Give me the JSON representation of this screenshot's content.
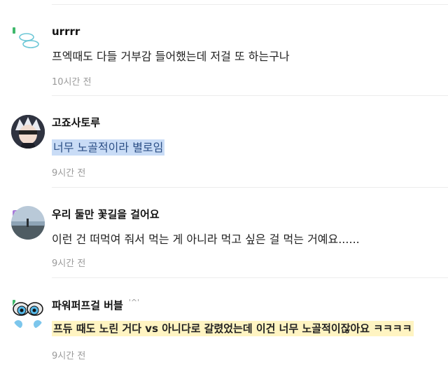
{
  "comments": [
    {
      "name": "urrrr",
      "name_extra": "",
      "text": "프엑때도 다들 거부감 들어했는데 저걸 또 하는구나",
      "time": "10시간 전"
    },
    {
      "name": "고죠사토루",
      "name_extra": "",
      "text": "너무 노골적이라 별로임",
      "time": "9시간 전"
    },
    {
      "name": "우리 둘만 꽃길을 걸어요",
      "name_extra": "",
      "text": "이런 건 떠먹여 줘서 먹는 게 아니라 먹고 싶은 걸 먹는 거예요......",
      "time": "9시간 전"
    },
    {
      "name": "파워퍼프걸 버블",
      "name_extra": "'^'",
      "text": "프듀 때도 노린 거다 vs 아니다로 갈렸었는데 이건 너무 노골적이잖아요 ㅋㅋㅋㅋ",
      "time": "9시간 전"
    }
  ],
  "colors": {
    "highlight_blue": "#c9dcf6",
    "highlight_yellow": "#fff4c2",
    "time_gray": "#9a9a9a"
  }
}
